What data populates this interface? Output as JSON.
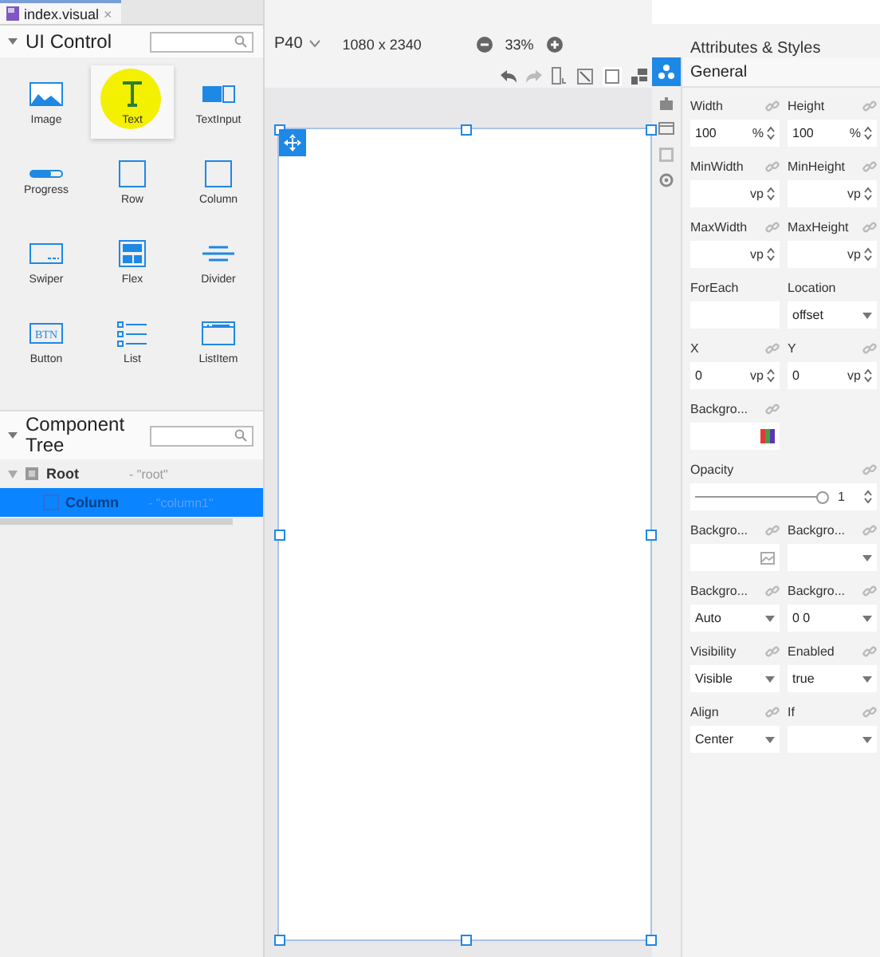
{
  "tab": {
    "title": "index.visual",
    "close": "×"
  },
  "ui_control": {
    "title": "UI Control",
    "items": [
      {
        "label": "Image",
        "kind": "image",
        "hovered": false
      },
      {
        "label": "Text",
        "kind": "text",
        "hovered": true
      },
      {
        "label": "TextInput",
        "kind": "textinput",
        "hovered": false
      },
      {
        "label": "Progress",
        "kind": "progress",
        "hovered": false
      },
      {
        "label": "Row",
        "kind": "row",
        "hovered": false
      },
      {
        "label": "Column",
        "kind": "column",
        "hovered": false
      },
      {
        "label": "Swiper",
        "kind": "swiper",
        "hovered": false
      },
      {
        "label": "Flex",
        "kind": "flex",
        "hovered": false
      },
      {
        "label": "Divider",
        "kind": "divider",
        "hovered": false
      },
      {
        "label": "Button",
        "kind": "button",
        "hovered": false,
        "icon_text": "BTN"
      },
      {
        "label": "List",
        "kind": "list",
        "hovered": false
      },
      {
        "label": "ListItem",
        "kind": "listitem",
        "hovered": false
      }
    ]
  },
  "component_tree": {
    "title": "Component Tree",
    "nodes": [
      {
        "name": "Root",
        "id": "- \"root\"",
        "expanded": true,
        "selected": false,
        "children": [
          {
            "name": "Column",
            "id": "- \"column1\"",
            "selected": true
          }
        ]
      }
    ]
  },
  "toolbar": {
    "device": "P40",
    "resolution": "1080 x 2340",
    "zoom": "33%"
  },
  "attributes": {
    "title": "Attributes & Styles",
    "section": "General",
    "rows": [
      {
        "fields": [
          {
            "kind": "number",
            "label": "Width",
            "value": "100",
            "unit": "%",
            "bindable": true
          },
          {
            "kind": "number",
            "label": "Height",
            "value": "100",
            "unit": "%",
            "bindable": true
          }
        ]
      },
      {
        "fields": [
          {
            "kind": "number",
            "label": "MinWidth",
            "unit": "vp",
            "bindable": true
          },
          {
            "kind": "number",
            "label": "MinHeight",
            "unit": "vp",
            "bindable": true
          }
        ]
      },
      {
        "fields": [
          {
            "kind": "number",
            "label": "MaxWidth",
            "unit": "vp",
            "bindable": true
          },
          {
            "kind": "number",
            "label": "MaxHeight",
            "unit": "vp",
            "bindable": true
          }
        ]
      },
      {
        "fields": [
          {
            "kind": "text",
            "label": "ForEach",
            "bindable": false
          },
          {
            "kind": "select",
            "label": "Location",
            "value": "offset",
            "bindable": false
          }
        ]
      },
      {
        "fields": [
          {
            "kind": "number",
            "label": "X",
            "value": "0",
            "unit": "vp",
            "bindable": true
          },
          {
            "kind": "number",
            "label": "Y",
            "value": "0",
            "unit": "vp",
            "bindable": true
          }
        ]
      },
      {
        "fields": [
          {
            "kind": "color",
            "label": "Backgro...",
            "bindable": true
          }
        ]
      },
      {
        "fields": [
          {
            "kind": "slider",
            "label": "Opacity",
            "value": "1",
            "level": 1,
            "bindable": true
          }
        ]
      },
      {
        "fields": [
          {
            "kind": "image",
            "label": "Backgro...",
            "bindable": true
          },
          {
            "kind": "select",
            "label": "Backgro...",
            "bindable": true
          }
        ]
      },
      {
        "fields": [
          {
            "kind": "select",
            "label": "Backgro...",
            "value": "Auto",
            "bindable": true
          },
          {
            "kind": "select",
            "label": "Backgro...",
            "value": "0 0",
            "bindable": true
          }
        ]
      },
      {
        "fields": [
          {
            "kind": "select",
            "label": "Visibility",
            "value": "Visible",
            "bindable": true
          },
          {
            "kind": "select",
            "label": "Enabled",
            "value": "true",
            "bindable": true
          }
        ]
      },
      {
        "fields": [
          {
            "kind": "select",
            "label": "Align",
            "value": "Center",
            "bindable": true
          },
          {
            "kind": "select",
            "label": "If",
            "bindable": true
          }
        ]
      }
    ]
  }
}
